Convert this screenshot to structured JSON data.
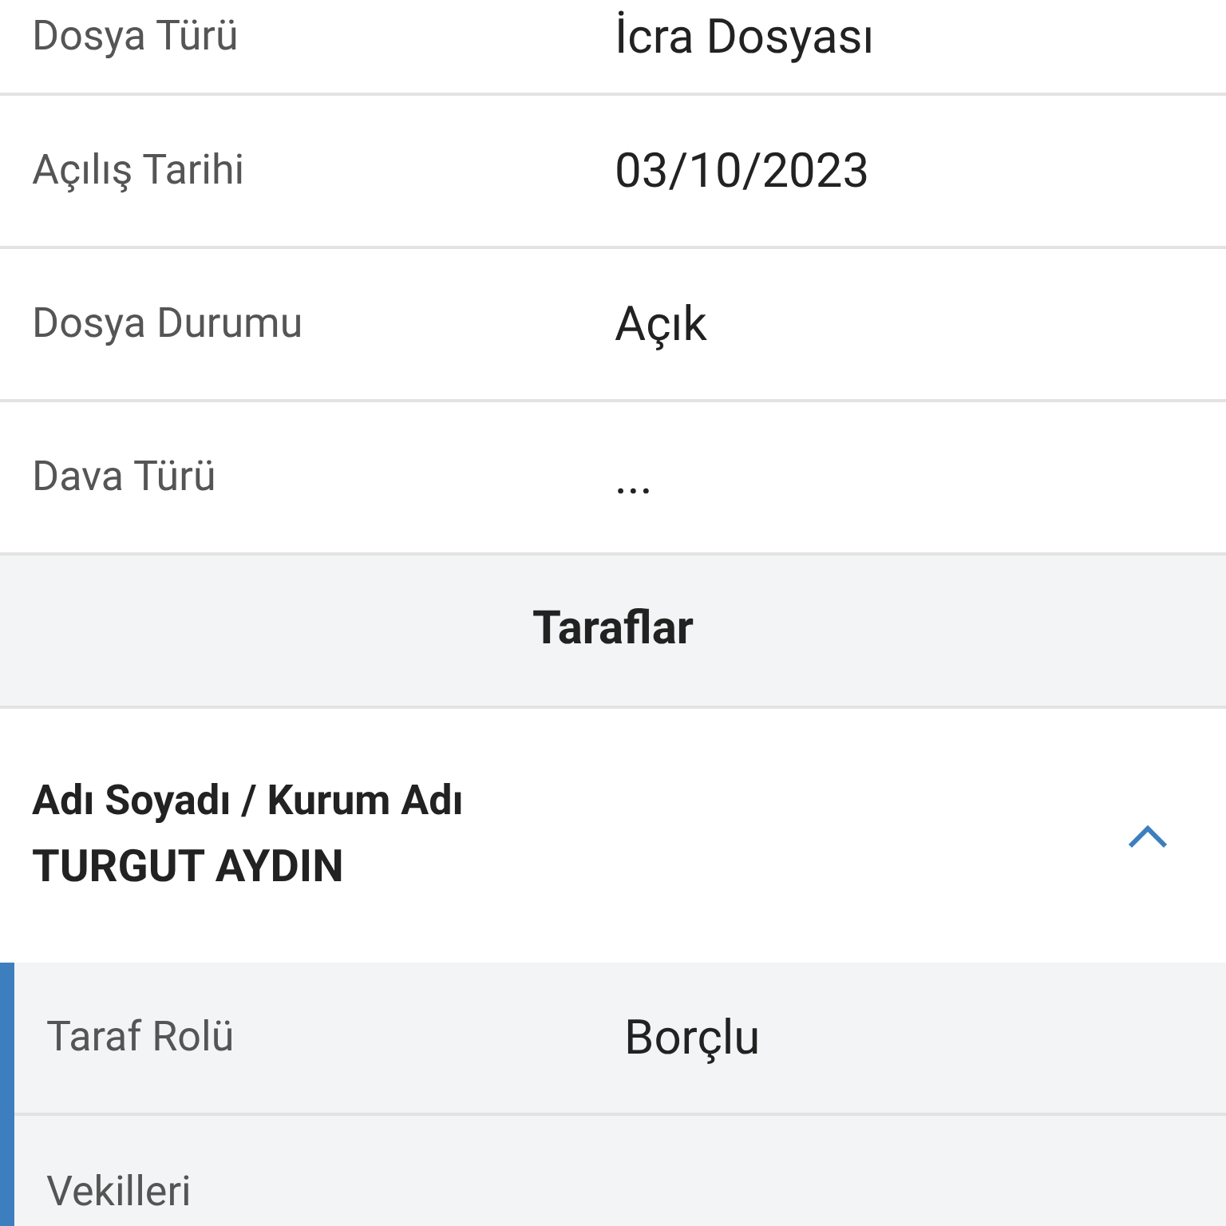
{
  "file_details": [
    {
      "label": "Dosya Türü",
      "value": "İcra Dosyası"
    },
    {
      "label": "Açılış Tarihi",
      "value": "03/10/2023"
    },
    {
      "label": "Dosya Durumu",
      "value": "Açık"
    },
    {
      "label": "Dava Türü",
      "value": "..."
    }
  ],
  "parties_section": {
    "title": "Taraflar",
    "parties": [
      {
        "name_label": "Adı Soyadı / Kurum Adı",
        "name": "TURGUT AYDIN",
        "expanded": true,
        "details": [
          {
            "label": "Taraf Rolü",
            "value": "Borçlu"
          },
          {
            "label": "Vekilleri"
          }
        ]
      }
    ]
  }
}
